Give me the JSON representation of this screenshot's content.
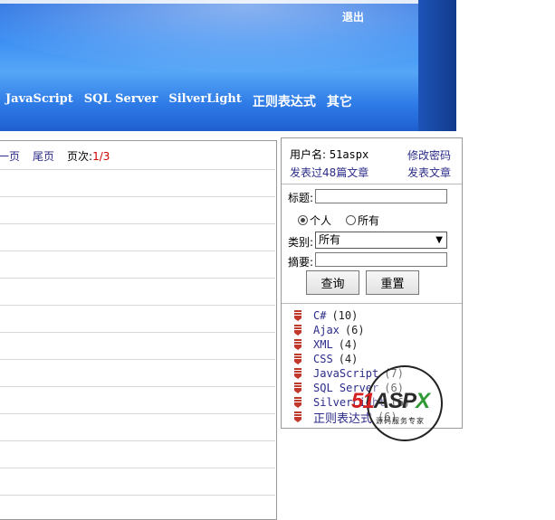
{
  "header": {
    "logout_label": "退出",
    "nav": [
      "JavaScript",
      "SQL Server",
      "SilverLight",
      "正则表达式",
      "其它"
    ]
  },
  "pager": {
    "prev_partial": "一页",
    "last_label": "尾页",
    "page_label": "页次:",
    "page_value": "1/3"
  },
  "user_panel": {
    "username_label": "用户名:",
    "username": "51aspx",
    "change_password": "修改密码",
    "posted_articles": "发表过48篇文章",
    "post_article": "发表文章"
  },
  "search": {
    "title_label": "标题:",
    "title_value": "",
    "scope_options": [
      "个人",
      "所有"
    ],
    "scope_selected": "个人",
    "category_label": "类别:",
    "category_selected": "所有",
    "summary_label": "摘要:",
    "summary_value": "",
    "query_button": "查询",
    "reset_button": "重置"
  },
  "categories": [
    {
      "name": "C#",
      "count": "(10)"
    },
    {
      "name": "Ajax",
      "count": "(6)"
    },
    {
      "name": "XML",
      "count": "(4)"
    },
    {
      "name": "CSS",
      "count": "(4)"
    },
    {
      "name": "JavaScript",
      "count": "(7)"
    },
    {
      "name": "SQL Server",
      "count": "(6)"
    },
    {
      "name": "SilverLight",
      "count": "(6)"
    },
    {
      "name": "正则表达式",
      "count": "(6)"
    }
  ],
  "watermark": {
    "brand_51": "51",
    "brand_asp": "ASP",
    "brand_x": "X",
    "tagline": "源码服务专家"
  },
  "colors": {
    "banner_blue": "#3c8ef2",
    "link": "#2b2b8a",
    "page_red": "#d00000",
    "icon_red": "#c0392b"
  }
}
